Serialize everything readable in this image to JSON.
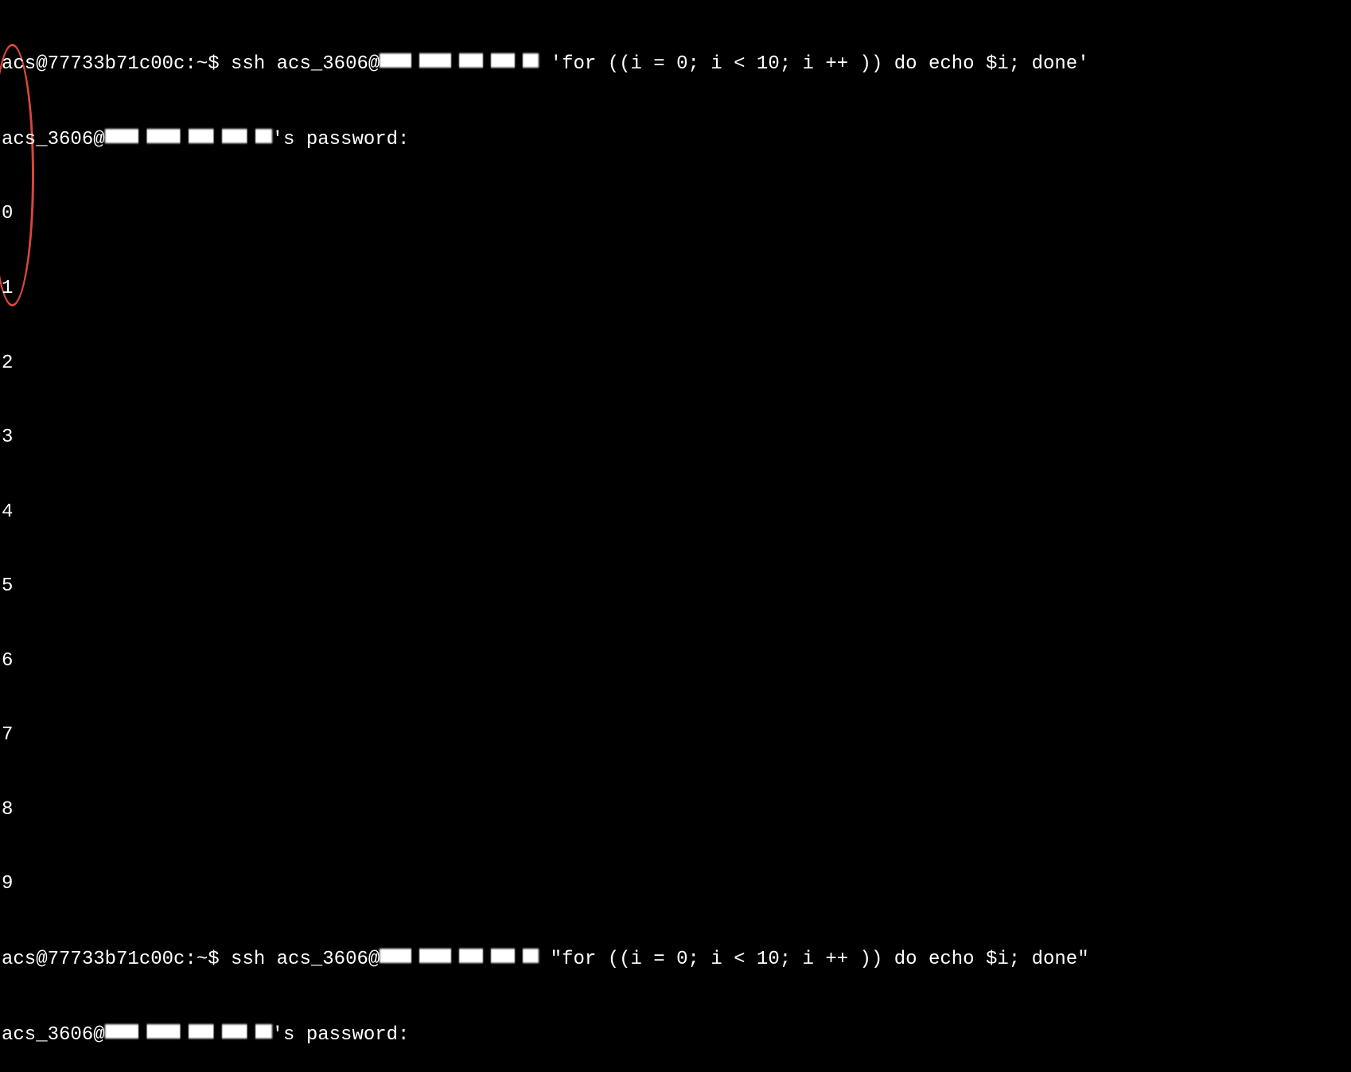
{
  "session1": {
    "prompt_prefix": "acs@77733b71c00c:~$ ",
    "command_start": "ssh acs_3606@",
    "host_redacted": "███.██.██.██",
    "command_end": " 'for ((i = 0; i < 10; i ++ )) do echo $i; done'",
    "password_prefix": "acs_3606@",
    "password_host_redacted": "███.██.██.███",
    "password_suffix": "'s password:",
    "output": [
      "0",
      "1",
      "2",
      "3",
      "4",
      "5",
      "6",
      "7",
      "8",
      "9"
    ]
  },
  "session2": {
    "prompt_prefix": "acs@77733b71c00c:~$ ",
    "command_start": "ssh acs_3606@",
    "host_redacted": "███.██.██.██",
    "command_end": " \"for ((i = 0; i < 10; i ++ )) do echo $i; done\"",
    "password_prefix": "acs_3606@",
    "password_host_redacted": "███.██.██.███",
    "password_suffix": "'s password:"
  },
  "annotation": {
    "color": "#d9483a",
    "shape": "ellipse",
    "around": "output-numbers"
  }
}
